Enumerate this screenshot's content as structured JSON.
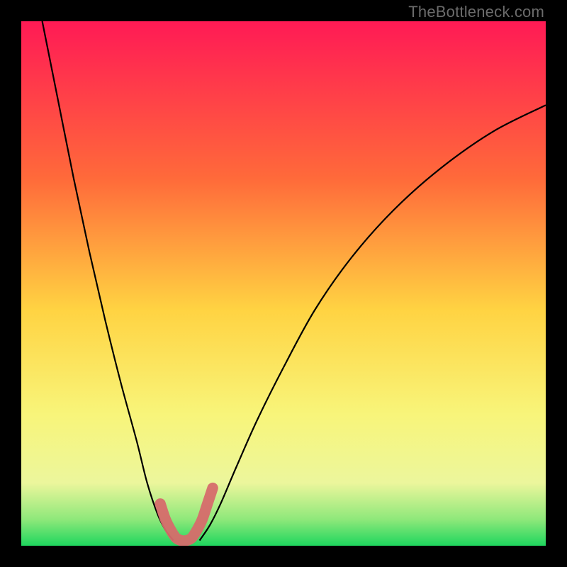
{
  "watermark": "TheBottleneck.com",
  "chart_data": {
    "type": "line",
    "title": "",
    "xlabel": "",
    "ylabel": "",
    "xlim": [
      0,
      100
    ],
    "ylim": [
      0,
      100
    ],
    "gradient_stops": [
      {
        "offset": 0,
        "color": "#ff1a55"
      },
      {
        "offset": 30,
        "color": "#ff6a3a"
      },
      {
        "offset": 55,
        "color": "#ffd342"
      },
      {
        "offset": 75,
        "color": "#f8f57a"
      },
      {
        "offset": 88,
        "color": "#ecf69c"
      },
      {
        "offset": 95,
        "color": "#8ee87a"
      },
      {
        "offset": 100,
        "color": "#1ed65e"
      }
    ],
    "series": [
      {
        "name": "left-branch",
        "x": [
          4,
          7,
          10,
          13,
          16,
          19,
          22,
          24,
          26,
          27.5,
          29
        ],
        "y": [
          100,
          85,
          70,
          56,
          43,
          31,
          20,
          12,
          6,
          3,
          1
        ]
      },
      {
        "name": "right-branch",
        "x": [
          34,
          36,
          38,
          41,
          45,
          50,
          56,
          63,
          71,
          80,
          90,
          100
        ],
        "y": [
          1,
          4,
          8,
          15,
          24,
          34,
          45,
          55,
          64,
          72,
          79,
          84
        ]
      }
    ],
    "highlight": {
      "name": "bottom-v",
      "color": "#d66b6b",
      "width": 2.2,
      "points_x": [
        26.5,
        27.5,
        28.5,
        29.5,
        30.5,
        31.5,
        32.5,
        33.5,
        34.5,
        35.5,
        36.5
      ],
      "points_y": [
        8,
        5,
        3,
        1.5,
        1,
        1,
        1.5,
        3,
        5,
        8,
        11
      ]
    }
  }
}
